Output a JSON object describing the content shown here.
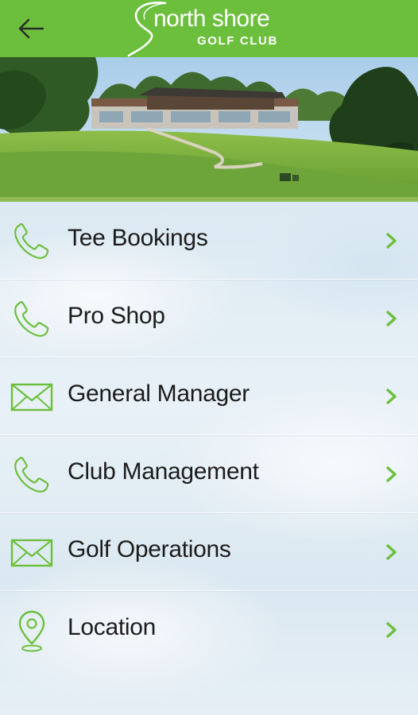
{
  "header": {
    "back_icon": "arrow-left-icon",
    "logo": {
      "line1": "north shore",
      "line2": "GOLF CLUB"
    },
    "background_color": "#6cbf3c"
  },
  "hero": {
    "description_icon": "clubhouse-photo"
  },
  "menu": {
    "accent_color": "#6cbf3c",
    "items": [
      {
        "label": "Tee Bookings",
        "icon": "phone-icon"
      },
      {
        "label": "Pro Shop",
        "icon": "phone-icon"
      },
      {
        "label": "General Manager",
        "icon": "mail-icon"
      },
      {
        "label": "Club Management",
        "icon": "phone-icon"
      },
      {
        "label": "Golf Operations",
        "icon": "mail-icon"
      },
      {
        "label": "Location",
        "icon": "location-pin-icon"
      }
    ],
    "chevron_icon": "chevron-right-icon"
  }
}
